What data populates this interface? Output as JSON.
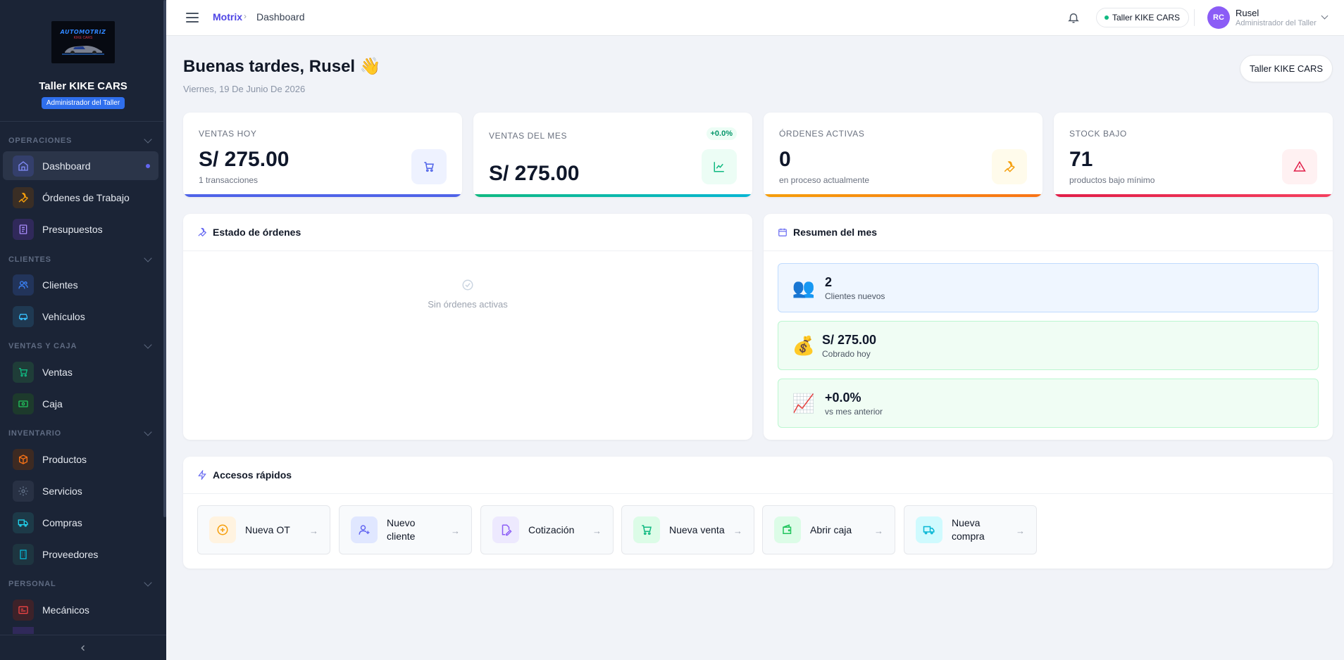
{
  "sidebar": {
    "logo_text": "AUTOMOTRIZ",
    "logo_subtext": "KIKE CARS",
    "shop_name": "Taller KIKE CARS",
    "role_badge": "Administrador del Taller",
    "sections": [
      {
        "title": "OPERACIONES",
        "items": [
          {
            "label": "Dashboard",
            "icon": "home-icon",
            "active": true
          },
          {
            "label": "Órdenes de Trabajo",
            "icon": "wrench-icon"
          },
          {
            "label": "Presupuestos",
            "icon": "document-icon"
          }
        ]
      },
      {
        "title": "CLIENTES",
        "items": [
          {
            "label": "Clientes",
            "icon": "users-icon"
          },
          {
            "label": "Vehículos",
            "icon": "car-icon"
          }
        ]
      },
      {
        "title": "VENTAS Y CAJA",
        "items": [
          {
            "label": "Ventas",
            "icon": "cart-icon"
          },
          {
            "label": "Caja",
            "icon": "cash-icon"
          }
        ]
      },
      {
        "title": "INVENTARIO",
        "items": [
          {
            "label": "Productos",
            "icon": "box-icon"
          },
          {
            "label": "Servicios",
            "icon": "gear-icon"
          },
          {
            "label": "Compras",
            "icon": "truck-icon"
          },
          {
            "label": "Proveedores",
            "icon": "building-icon"
          }
        ]
      },
      {
        "title": "PERSONAL",
        "items": [
          {
            "label": "Mecánicos",
            "icon": "id-card-icon"
          }
        ]
      }
    ]
  },
  "topbar": {
    "app_name": "Motrix",
    "breadcrumb_sep": "›",
    "page": "Dashboard",
    "shop_pill": "Taller KIKE CARS",
    "user_initials": "RC",
    "user_name": "Rusel",
    "user_role": "Administrador del Taller"
  },
  "header": {
    "greeting": "Buenas tardes, Rusel 👋",
    "date": "Viernes, 19 De Junio De 2026",
    "shop_button": "Taller KIKE CARS"
  },
  "stats": [
    {
      "label": "VENTAS HOY",
      "value": "S/ 275.00",
      "sub": "1 transacciones",
      "icon": "cart-icon",
      "color": "#4f63e8"
    },
    {
      "label": "VENTAS DEL MES",
      "value": "S/ 275.00",
      "badge": "+0.0%",
      "icon": "trend-chart-icon",
      "color": "#14b8a6"
    },
    {
      "label": "ÓRDENES ACTIVAS",
      "value": "0",
      "sub": "en proceso actualmente",
      "icon": "wrench-icon",
      "color": "#f59e0b"
    },
    {
      "label": "STOCK BAJO",
      "value": "71",
      "sub": "productos bajo mínimo",
      "icon": "warning-icon",
      "color": "#e11d48"
    }
  ],
  "orders_panel": {
    "title": "Estado de órdenes",
    "empty_text": "Sin órdenes activas"
  },
  "summary_panel": {
    "title": "Resumen del mes",
    "items": [
      {
        "value": "2",
        "label": "Clientes nuevos",
        "emoji": "👥"
      },
      {
        "value": "S/ 275.00",
        "label": "Cobrado hoy",
        "emoji": "💰"
      },
      {
        "value": "+0.0%",
        "label": "vs mes anterior",
        "emoji": "📈"
      }
    ]
  },
  "quick_access": {
    "title": "Accesos rápidos",
    "items": [
      {
        "label": "Nueva OT",
        "icon": "plus-circle-icon"
      },
      {
        "label": "Nuevo cliente",
        "icon": "user-plus-icon"
      },
      {
        "label": "Cotización",
        "icon": "edit-document-icon"
      },
      {
        "label": "Nueva venta",
        "icon": "cart-icon"
      },
      {
        "label": "Abrir caja",
        "icon": "wallet-icon"
      },
      {
        "label": "Nueva compra",
        "icon": "truck-icon"
      }
    ],
    "arrow": "→"
  }
}
